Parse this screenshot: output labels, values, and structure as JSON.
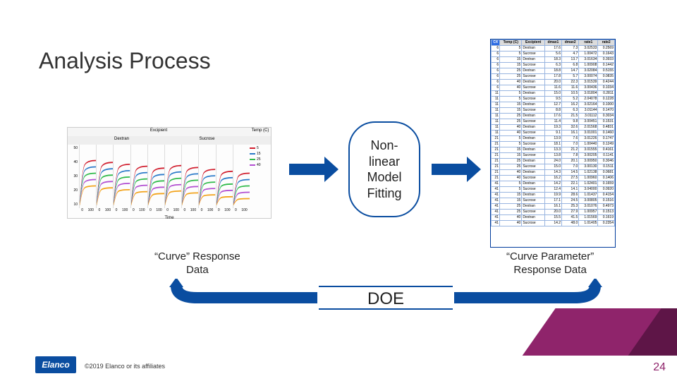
{
  "title": "Analysis Process",
  "nonlinear": "Non-\nlinear\nModel\nFitting",
  "caption_left": "“Curve” Response\nData",
  "caption_right": "“Curve Parameter”\nResponse Data",
  "doe": "DOE",
  "logo": "Elanco",
  "copyright": "©2019 Elanco or its affiliates",
  "page": "24",
  "graph": {
    "excipient_label": "Excipient",
    "temp_label": "Temp (C)",
    "sub_left": "Dextran",
    "sub_right": "Sucrose",
    "y_ticks": [
      "50",
      "40",
      "30",
      "20",
      "10"
    ],
    "x_label": "Time",
    "x_ticks": [
      "0",
      "100",
      "0",
      "100",
      "0",
      "100",
      "0",
      "100",
      "0",
      "100"
    ],
    "legend_temps": [
      "5",
      "15",
      "25",
      "40"
    ],
    "facet_count": 5,
    "colors": [
      "#d11f2f",
      "#2b7ac9",
      "#2fba4a",
      "#b24fd1",
      "#f2a31b"
    ]
  },
  "table": {
    "headers": [
      "C4",
      "Temp (C)",
      "Excipient",
      "dmax1",
      "dmax2",
      "rate1",
      "rate2"
    ],
    "rows": [
      [
        "6",
        "5",
        "Dextran",
        "17.6",
        "7.3",
        "3.02533",
        "0.2569"
      ],
      [
        "6",
        "5",
        "Sucrose",
        "5.6",
        "4.7",
        "1.00472",
        "0.1643"
      ],
      [
        "6",
        "15",
        "Dextran",
        "18.3",
        "13.7",
        "3.01634",
        "0.3933"
      ],
      [
        "6",
        "15",
        "Sucrose",
        "6.3",
        "6.8",
        "1.00908",
        "0.1442"
      ],
      [
        "6",
        "25",
        "Dextran",
        "18.8",
        "14.7",
        "3.02084",
        "0.5155"
      ],
      [
        "6",
        "25",
        "Sucrose",
        "17.8",
        "5.7",
        "3.00074",
        "0.0835"
      ],
      [
        "6",
        "40",
        "Dextran",
        "20.0",
        "22.3",
        "3.01539",
        "0.4244"
      ],
      [
        "6",
        "40",
        "Sucrose",
        "11.6",
        "11.6",
        "3.00436",
        "0.1034"
      ],
      [
        "11",
        "5",
        "Dextran",
        "15.0",
        "10.5",
        "3.01804",
        "0.2811"
      ],
      [
        "11",
        "5",
        "Sucrose",
        "9.5",
        "5.2",
        "2.04078",
        "0.1228"
      ],
      [
        "11",
        "15",
        "Dextran",
        "12.7",
        "16.2",
        "3.02164",
        "0.1000"
      ],
      [
        "11",
        "15",
        "Sucrose",
        "8.8",
        "6.3",
        "3.01144",
        "0.1470"
      ],
      [
        "11",
        "25",
        "Dextran",
        "17.6",
        "21.5",
        "3.01112",
        "0.3034"
      ],
      [
        "11",
        "25",
        "Sucrose",
        "11.4",
        "9.8",
        "3.00451",
        "0.1531"
      ],
      [
        "11",
        "40",
        "Dextran",
        "19.3",
        "32.6",
        "2.01568",
        "0.4831"
      ],
      [
        "11",
        "40",
        "Sucrose",
        "9.1",
        "16.1",
        "3.01001",
        "0.1460"
      ],
      [
        "21",
        "5",
        "Dextran",
        "13.9",
        "7.6",
        "3.01226",
        "0.1747"
      ],
      [
        "21",
        "5",
        "Sucrose",
        "18.1",
        "7.0",
        "1.00440",
        "0.1249"
      ],
      [
        "21",
        "15",
        "Dextran",
        "13.3",
        "21.2",
        "3.01555",
        "0.4161"
      ],
      [
        "21",
        "15",
        "Sucrose",
        "13.8",
        "7.8",
        "3.00205",
        "0.1141"
      ],
      [
        "21",
        "25",
        "Dextran",
        "24.0",
        "20.1",
        "3.00950",
        "0.3046"
      ],
      [
        "21",
        "25",
        "Sucrose",
        "15.0",
        "7.0",
        "3.00130",
        "0.1511"
      ],
      [
        "21",
        "40",
        "Dextran",
        "14.3",
        "14.5",
        "1.02138",
        "0.0681"
      ],
      [
        "21",
        "40",
        "Sucrose",
        "16.2",
        "27.5",
        "1.00960",
        "0.1406"
      ],
      [
        "41",
        "5",
        "Dextran",
        "14.2",
        "22.1",
        "1.02401",
        "0.1659"
      ],
      [
        "41",
        "5",
        "Sucrose",
        "12.4",
        "14.1",
        "3.04000",
        "0.0920"
      ],
      [
        "41",
        "15",
        "Dextran",
        "19.9",
        "28.6",
        "1.01437",
        "0.4154"
      ],
      [
        "41",
        "15",
        "Sucrose",
        "17.1",
        "24.5",
        "3.00805",
        "0.1516"
      ],
      [
        "41",
        "25",
        "Dextran",
        "16.1",
        "25.3",
        "3.01076",
        "0.4973"
      ],
      [
        "41",
        "25",
        "Sucrose",
        "20.0",
        "27.9",
        "1.00957",
        "0.1513"
      ],
      [
        "41",
        "40",
        "Dextran",
        "15.5",
        "41.5",
        "1.01569",
        "0.1619"
      ],
      [
        "41",
        "40",
        "Sucrose",
        "14.2",
        "48.0",
        "1.01405",
        "0.2354"
      ]
    ]
  }
}
